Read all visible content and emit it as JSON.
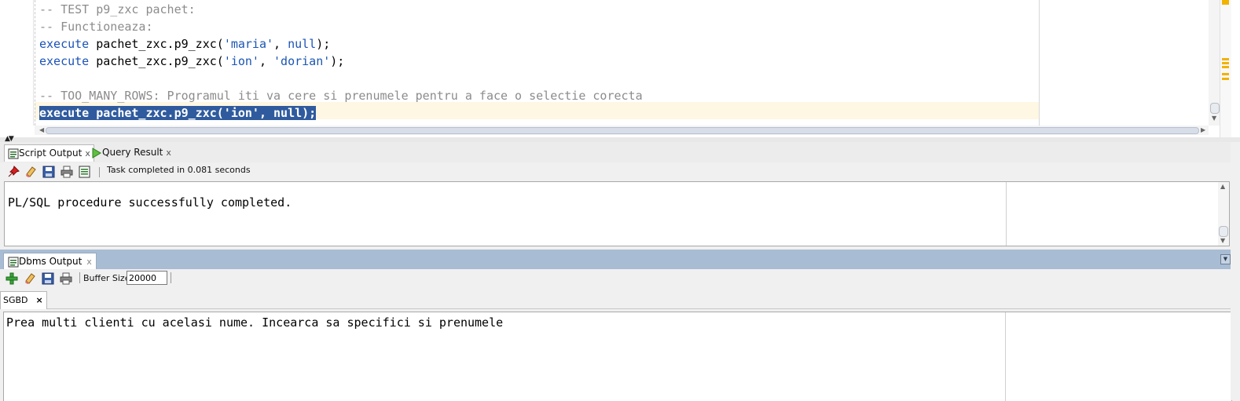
{
  "editor": {
    "lines": [
      {
        "parts": [
          {
            "t": "-- TEST p9_zxc pachet:",
            "c": "comment"
          }
        ]
      },
      {
        "parts": [
          {
            "t": "-- Functioneaza:",
            "c": "comment"
          }
        ]
      },
      {
        "parts": [
          {
            "t": "execute",
            "c": "kw"
          },
          {
            "t": " pachet_zxc.p9_zxc(",
            "c": ""
          },
          {
            "t": "'maria'",
            "c": "str"
          },
          {
            "t": ", ",
            "c": ""
          },
          {
            "t": "null",
            "c": "kw"
          },
          {
            "t": ");",
            "c": ""
          }
        ]
      },
      {
        "parts": [
          {
            "t": "execute",
            "c": "kw"
          },
          {
            "t": " pachet_zxc.p9_zxc(",
            "c": ""
          },
          {
            "t": "'ion'",
            "c": "str"
          },
          {
            "t": ", ",
            "c": ""
          },
          {
            "t": "'dorian'",
            "c": "str"
          },
          {
            "t": ");",
            "c": ""
          }
        ]
      },
      {
        "parts": [
          {
            "t": "",
            "c": ""
          }
        ]
      },
      {
        "parts": [
          {
            "t": "-- TOO_MANY_ROWS: Programul iti va cere si prenumele pentru a face o selectie corecta",
            "c": "comment"
          }
        ]
      },
      {
        "selected": true,
        "parts": [
          {
            "t": "execute",
            "c": "kw"
          },
          {
            "t": " pachet_zxc.p9_zxc('ion', ",
            "c": ""
          },
          {
            "t": "null",
            "c": "kw"
          },
          {
            "t": ");",
            "c": ""
          }
        ]
      }
    ]
  },
  "script_panel": {
    "tabs": [
      {
        "label": "Script Output",
        "close": "x",
        "icon": "script-output-icon"
      },
      {
        "label": "Query Result",
        "close": "x",
        "icon": "run-triangle-icon"
      }
    ],
    "toolbar_icons": [
      "pin-icon",
      "eraser-icon",
      "save-icon",
      "print-icon",
      "export-icon"
    ],
    "status": "Task completed in 0.081 seconds",
    "output": "PL/SQL procedure successfully completed."
  },
  "dbms_panel": {
    "tab_label": "Dbms Output",
    "tab_close": "x",
    "toolbar_icons": [
      "add-connection-icon",
      "eraser-icon",
      "save-icon",
      "print-icon"
    ],
    "buffer_label": "Buffer Size:",
    "buffer_value": "20000",
    "connection_tab": "SGBD",
    "connection_close": "×",
    "output": "Prea multi clienti cu acelasi nume. Incearca sa specifici si prenumele"
  },
  "colors": {
    "keyword": "#1c53b8",
    "comment": "#8c8c8c",
    "selection": "#2f5b9e",
    "dbms_header": "#a8bcd4"
  }
}
